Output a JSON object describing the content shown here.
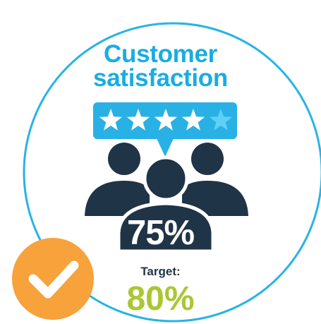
{
  "title": {
    "line1": "Customer",
    "line2": "satisfaction"
  },
  "rating": {
    "stars_filled": 4,
    "stars_total": 5,
    "value_text": "75%"
  },
  "target": {
    "label": "Target:",
    "value_text": "80%"
  },
  "icons": [
    "star-rating-bubble",
    "people-group-icon",
    "checkmark-badge-icon"
  ],
  "colors": {
    "circle_outline": "#28b3e6",
    "title": "#1aace3",
    "bubble": "#29b1e5",
    "star_filled": "#ffffff",
    "star_empty": "#5fd0f5",
    "people": "#1f3446",
    "target_value": "#a9c733",
    "check_badge": "#f7a23b"
  }
}
